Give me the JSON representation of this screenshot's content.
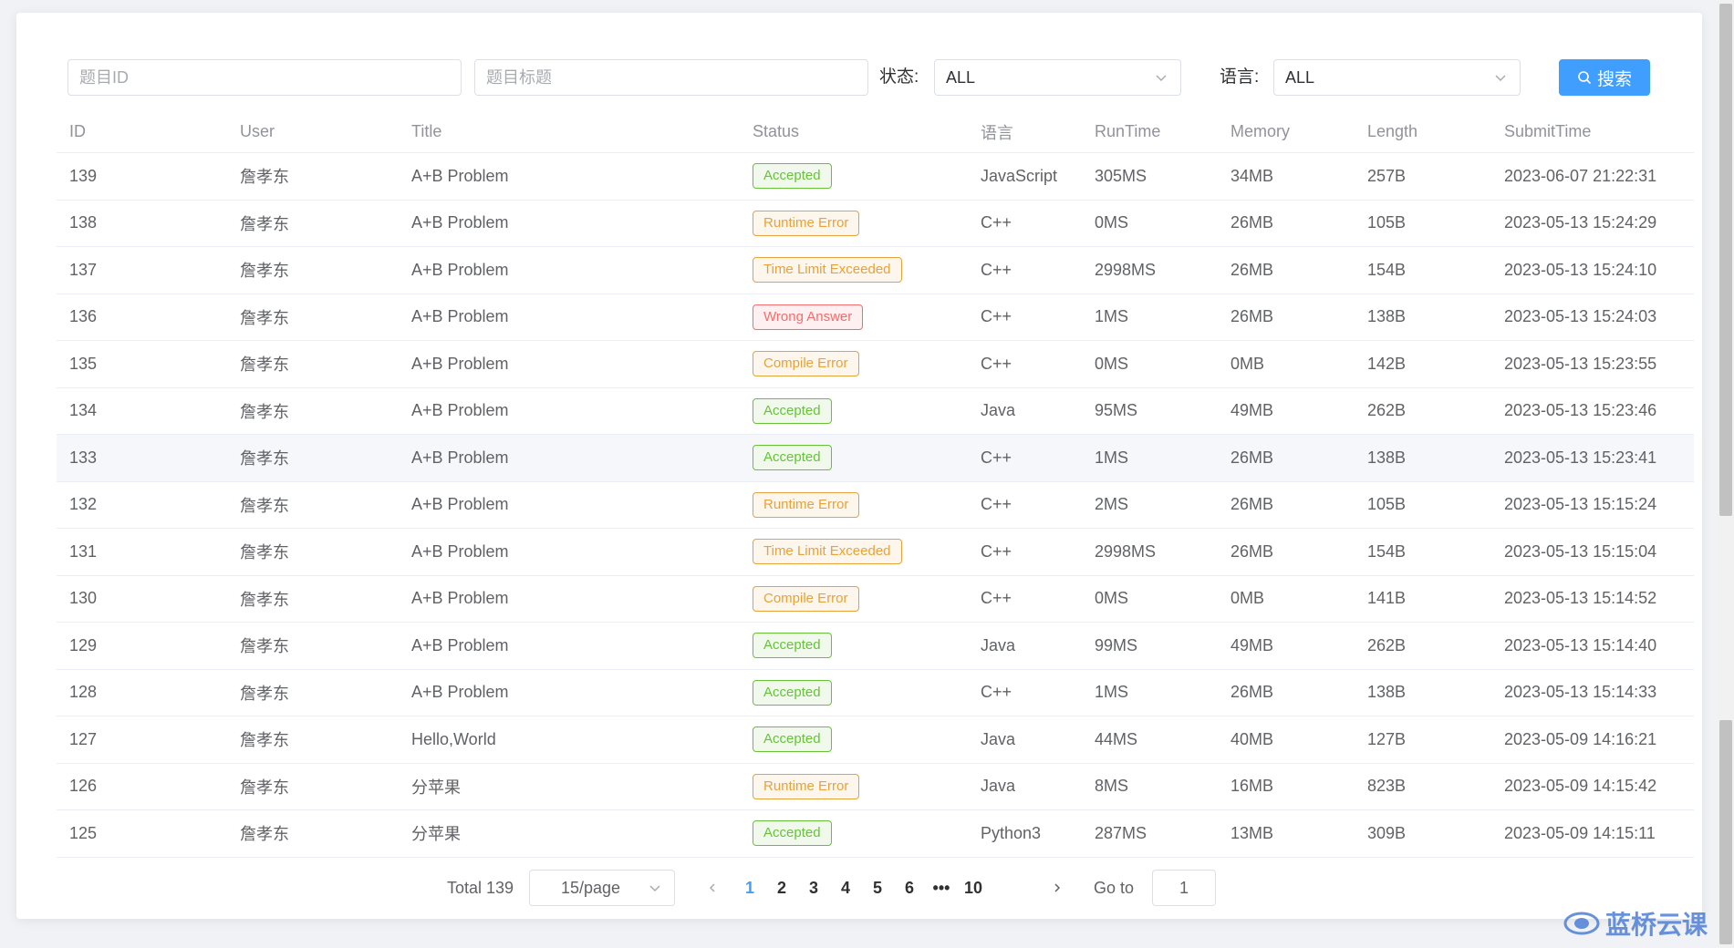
{
  "filters": {
    "problem_id_placeholder": "题目ID",
    "problem_title_placeholder": "题目标题",
    "status_label": "状态:",
    "status_value": "ALL",
    "language_label": "语言:",
    "language_value": "ALL",
    "search_label": "搜索"
  },
  "table": {
    "headers": [
      "ID",
      "User",
      "Title",
      "Status",
      "语言",
      "RunTime",
      "Memory",
      "Length",
      "SubmitTime"
    ],
    "rows": [
      {
        "id": "139",
        "user": "詹孝东",
        "title": "A+B Problem",
        "status": "Accepted",
        "status_type": "success",
        "lang": "JavaScript",
        "runtime": "305MS",
        "memory": "34MB",
        "length": "257B",
        "time": "2023-06-07 21:22:31"
      },
      {
        "id": "138",
        "user": "詹孝东",
        "title": "A+B Problem",
        "status": "Runtime Error",
        "status_type": "warning",
        "lang": "C++",
        "runtime": "0MS",
        "memory": "26MB",
        "length": "105B",
        "time": "2023-05-13 15:24:29"
      },
      {
        "id": "137",
        "user": "詹孝东",
        "title": "A+B Problem",
        "status": "Time Limit Exceeded",
        "status_type": "warning",
        "lang": "C++",
        "runtime": "2998MS",
        "memory": "26MB",
        "length": "154B",
        "time": "2023-05-13 15:24:10"
      },
      {
        "id": "136",
        "user": "詹孝东",
        "title": "A+B Problem",
        "status": "Wrong Answer",
        "status_type": "danger",
        "lang": "C++",
        "runtime": "1MS",
        "memory": "26MB",
        "length": "138B",
        "time": "2023-05-13 15:24:03"
      },
      {
        "id": "135",
        "user": "詹孝东",
        "title": "A+B Problem",
        "status": "Compile Error",
        "status_type": "warning",
        "lang": "C++",
        "runtime": "0MS",
        "memory": "0MB",
        "length": "142B",
        "time": "2023-05-13 15:23:55"
      },
      {
        "id": "134",
        "user": "詹孝东",
        "title": "A+B Problem",
        "status": "Accepted",
        "status_type": "success",
        "lang": "Java",
        "runtime": "95MS",
        "memory": "49MB",
        "length": "262B",
        "time": "2023-05-13 15:23:46"
      },
      {
        "id": "133",
        "user": "詹孝东",
        "title": "A+B Problem",
        "status": "Accepted",
        "status_type": "success",
        "lang": "C++",
        "runtime": "1MS",
        "memory": "26MB",
        "length": "138B",
        "time": "2023-05-13 15:23:41",
        "hover": true
      },
      {
        "id": "132",
        "user": "詹孝东",
        "title": "A+B Problem",
        "status": "Runtime Error",
        "status_type": "warning",
        "lang": "C++",
        "runtime": "2MS",
        "memory": "26MB",
        "length": "105B",
        "time": "2023-05-13 15:15:24"
      },
      {
        "id": "131",
        "user": "詹孝东",
        "title": "A+B Problem",
        "status": "Time Limit Exceeded",
        "status_type": "warning",
        "lang": "C++",
        "runtime": "2998MS",
        "memory": "26MB",
        "length": "154B",
        "time": "2023-05-13 15:15:04"
      },
      {
        "id": "130",
        "user": "詹孝东",
        "title": "A+B Problem",
        "status": "Compile Error",
        "status_type": "warning",
        "lang": "C++",
        "runtime": "0MS",
        "memory": "0MB",
        "length": "141B",
        "time": "2023-05-13 15:14:52"
      },
      {
        "id": "129",
        "user": "詹孝东",
        "title": "A+B Problem",
        "status": "Accepted",
        "status_type": "success",
        "lang": "Java",
        "runtime": "99MS",
        "memory": "49MB",
        "length": "262B",
        "time": "2023-05-13 15:14:40"
      },
      {
        "id": "128",
        "user": "詹孝东",
        "title": "A+B Problem",
        "status": "Accepted",
        "status_type": "success",
        "lang": "C++",
        "runtime": "1MS",
        "memory": "26MB",
        "length": "138B",
        "time": "2023-05-13 15:14:33"
      },
      {
        "id": "127",
        "user": "詹孝东",
        "title": "Hello,World",
        "status": "Accepted",
        "status_type": "success",
        "lang": "Java",
        "runtime": "44MS",
        "memory": "40MB",
        "length": "127B",
        "time": "2023-05-09 14:16:21"
      },
      {
        "id": "126",
        "user": "詹孝东",
        "title": "分苹果",
        "status": "Runtime Error",
        "status_type": "warning",
        "lang": "Java",
        "runtime": "8MS",
        "memory": "16MB",
        "length": "823B",
        "time": "2023-05-09 14:15:42"
      },
      {
        "id": "125",
        "user": "詹孝东",
        "title": "分苹果",
        "status": "Accepted",
        "status_type": "success",
        "lang": "Python3",
        "runtime": "287MS",
        "memory": "13MB",
        "length": "309B",
        "time": "2023-05-09 14:15:11"
      }
    ]
  },
  "pagination": {
    "total": "Total 139",
    "page_size": "15/page",
    "pages": [
      "1",
      "2",
      "3",
      "4",
      "5",
      "6",
      "•••",
      "10"
    ],
    "current": "1",
    "goto_label": "Go to",
    "goto_value": "1"
  },
  "watermark": "蓝桥云课",
  "colors": {
    "primary": "#409eff",
    "success": "#67c23a",
    "warning": "#e6a23c",
    "danger": "#f56c6c"
  }
}
